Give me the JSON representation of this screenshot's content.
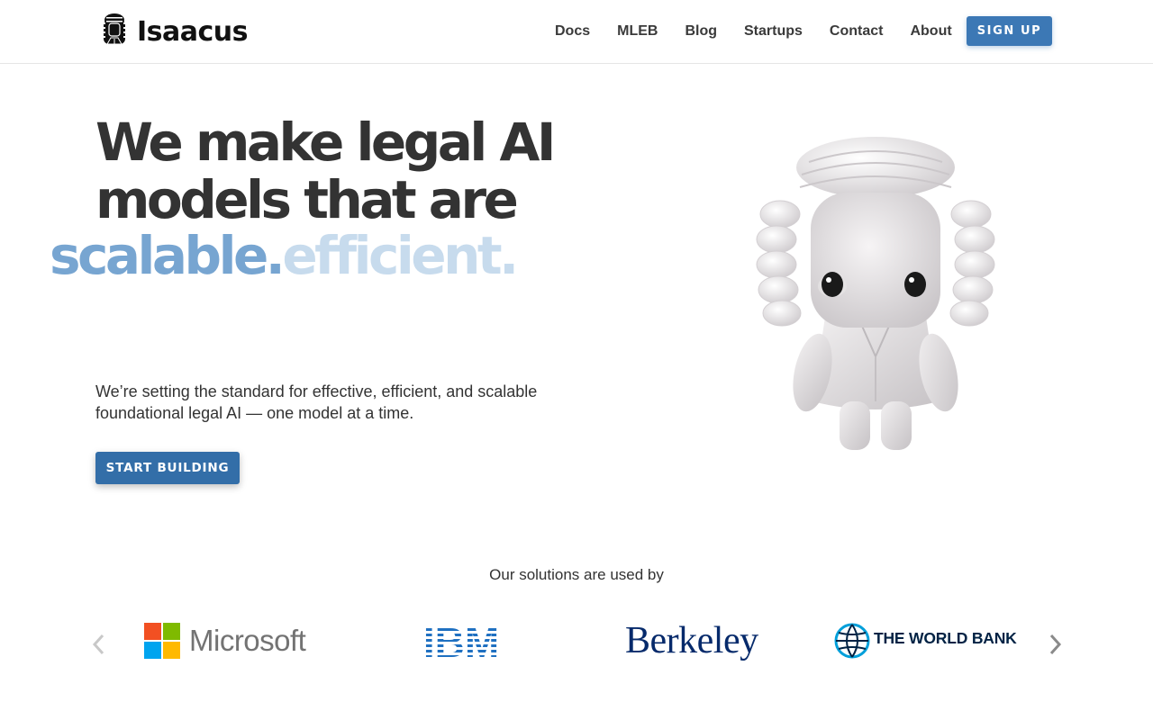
{
  "brand": {
    "name": "Isaacus",
    "logo_icon": "judge-wig-icon"
  },
  "nav": {
    "items": [
      {
        "label": "Docs"
      },
      {
        "label": "MLEB"
      },
      {
        "label": "Blog"
      },
      {
        "label": "Startups"
      },
      {
        "label": "Contact"
      },
      {
        "label": "About"
      }
    ],
    "signup_label": "SIGN UP"
  },
  "hero": {
    "headline_line1": "We make legal AI",
    "headline_line2": "models that are",
    "rotating_words": [
      "scalable.",
      "efficient."
    ],
    "subtitle": "We’re setting the standard for effective, efficient, and scalable foundational legal AI — one model at a time.",
    "cta_label": "START BUILDING",
    "mascot": "judge-wig-mascot"
  },
  "clients": {
    "title": "Our solutions are used by",
    "logos": [
      {
        "name": "Microsoft",
        "text": "Microsoft"
      },
      {
        "name": "IBM",
        "text": "IBM"
      },
      {
        "name": "Berkeley",
        "text": "Berkeley"
      },
      {
        "name": "The World Bank",
        "text": "THE WORLD BANK"
      }
    ],
    "prev_icon": "chevron-left-icon",
    "next_icon": "chevron-right-icon"
  },
  "colors": {
    "accent": "#3c78b5",
    "rotating_primary": "#77a5d1",
    "rotating_faded": "#c7dbed",
    "text": "#333333"
  }
}
